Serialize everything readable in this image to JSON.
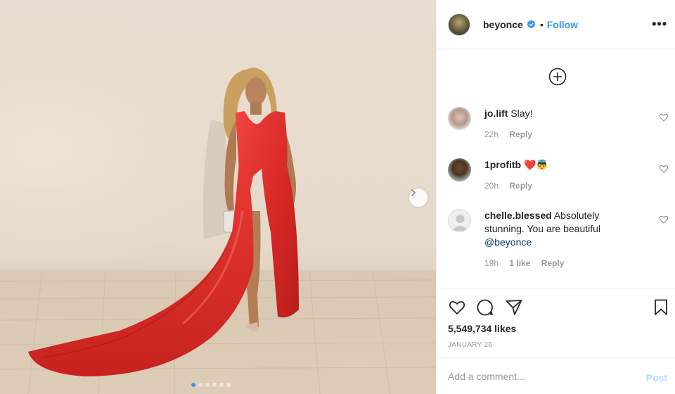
{
  "post": {
    "author": "beyonce",
    "follow_label": "Follow",
    "separator": "•",
    "more_label": "•••",
    "verified": true,
    "carousel": {
      "slide_count": 6,
      "active_index": 0
    },
    "likes": "5,549,734 likes",
    "date": "JANUARY 26"
  },
  "comments": [
    {
      "user": "jo.lift",
      "text": "Slay!",
      "time": "22h",
      "likes": "",
      "reply": "Reply"
    },
    {
      "user": "1profitb",
      "text": "❤️👼",
      "time": "20h",
      "likes": "",
      "reply": "Reply"
    },
    {
      "user": "chelle.blessed",
      "text": "Absolutely stunning. You are beautiful",
      "mention": "@beyonce",
      "time": "19h",
      "likes": "1 like",
      "reply": "Reply"
    }
  ],
  "composer": {
    "placeholder": "Add a comment...",
    "post_label": "Post"
  },
  "icons": {
    "load_more": "plus-circle-icon",
    "like": "heart-icon",
    "comment": "comment-bubble-icon",
    "share": "paper-plane-icon",
    "save": "bookmark-icon",
    "next": "chevron-right-icon"
  },
  "colors": {
    "link": "#3897f0",
    "muted": "#999999",
    "text": "#262626",
    "dress": "#e3302d"
  }
}
